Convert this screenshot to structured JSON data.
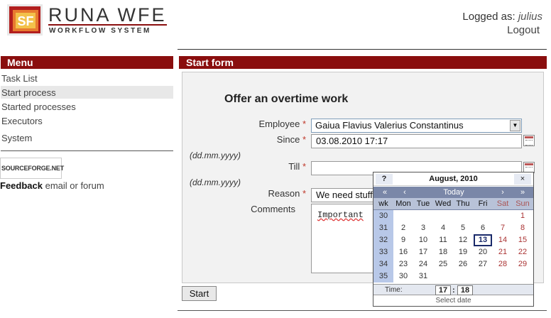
{
  "header": {
    "brand": "RUNA WFE",
    "tagline": "WORKFLOW SYSTEM",
    "logo_letters": "SF",
    "logged_prefix": "Logged as:",
    "user": "julius",
    "logout": "Logout"
  },
  "menu": {
    "title": "Menu",
    "items": [
      "Task List",
      "Start process",
      "Started processes",
      "Executors",
      "System"
    ],
    "sourceforge": "SOURCEFORGE.NET",
    "feedback_bold": "Feedback",
    "feedback_rest": " email or forum"
  },
  "form": {
    "bar_title": "Start form",
    "title": "Offer an overtime work",
    "employee_label": "Employee",
    "employee_value": "Gaiua Flavius Valerius Constantinus",
    "since_label": "Since",
    "since_value": "03.08.2010 17:17",
    "date_hint": "(dd.mm.yyyy)",
    "till_label": "Till",
    "till_value": "",
    "reason_label": "Reason",
    "reason_value": "We need stuff",
    "comments_label": "Comments",
    "comments_value": "Important",
    "required_mark": "*",
    "start_button": "Start"
  },
  "calendar": {
    "help": "?",
    "month": "August, 2010",
    "close": "×",
    "prev_year": "«",
    "prev_month": "‹",
    "today": "Today",
    "next_month": "›",
    "next_year": "»",
    "headers": [
      "wk",
      "Mon",
      "Tue",
      "Wed",
      "Thu",
      "Fri",
      "Sat",
      "Sun"
    ],
    "weeks": [
      {
        "wk": "30",
        "days": [
          "",
          "",
          "",
          "",
          "",
          "",
          "1"
        ]
      },
      {
        "wk": "31",
        "days": [
          "2",
          "3",
          "4",
          "5",
          "6",
          "7",
          "8"
        ]
      },
      {
        "wk": "32",
        "days": [
          "9",
          "10",
          "11",
          "12",
          "13",
          "14",
          "15"
        ]
      },
      {
        "wk": "33",
        "days": [
          "16",
          "17",
          "18",
          "19",
          "20",
          "21",
          "22"
        ]
      },
      {
        "wk": "34",
        "days": [
          "23",
          "24",
          "25",
          "26",
          "27",
          "28",
          "29"
        ]
      },
      {
        "wk": "35",
        "days": [
          "30",
          "31",
          "",
          "",
          "",
          "",
          ""
        ]
      }
    ],
    "today_day": "13",
    "time_label": "Time:",
    "hour": "17",
    "minute": "18",
    "select_date": "Select date"
  }
}
